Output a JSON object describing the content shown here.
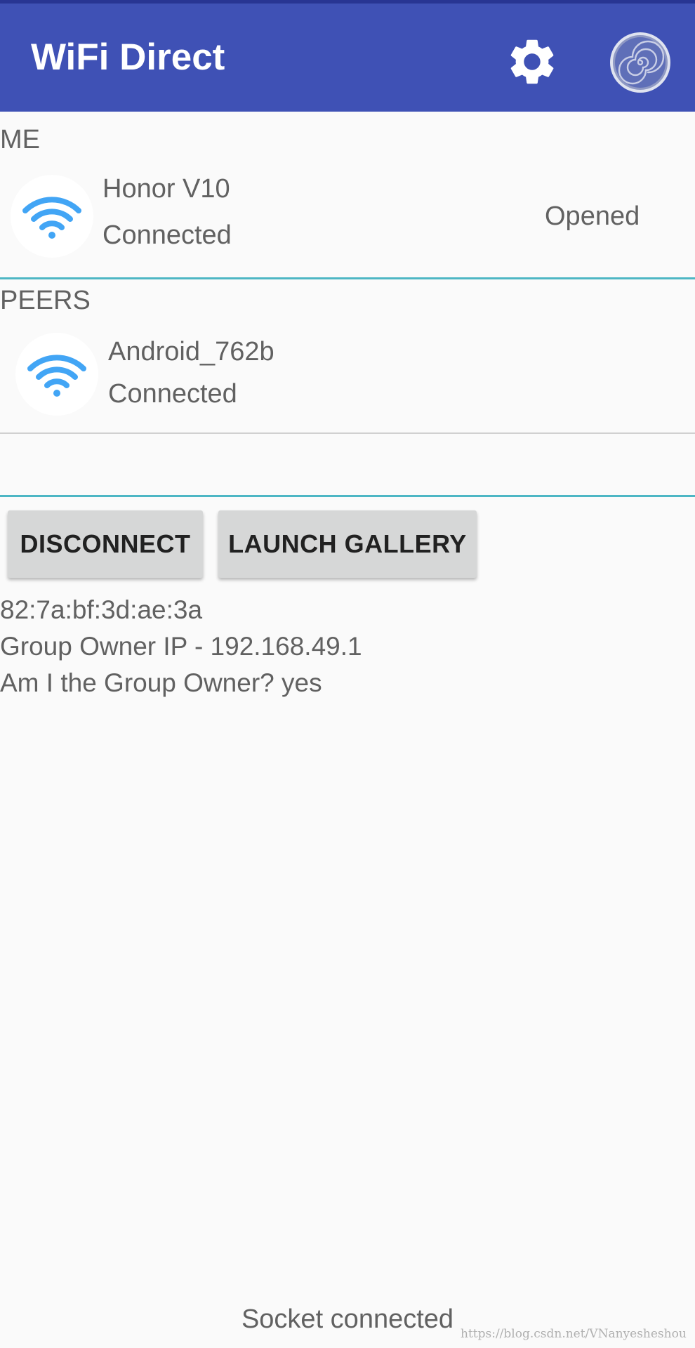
{
  "appbar": {
    "title": "WiFi Direct",
    "color": "#3f51b5",
    "actions": [
      {
        "icon": "gear-icon"
      },
      {
        "icon": "spiral-icon"
      }
    ]
  },
  "me": {
    "section_label": "ME",
    "device": {
      "name": "Honor V10",
      "status": "Connected",
      "state": "Opened",
      "icon": "wifi-icon"
    }
  },
  "peers": {
    "section_label": "PEERS",
    "items": [
      {
        "name": "Android_762b",
        "status": "Connected",
        "icon": "wifi-icon"
      }
    ]
  },
  "actions": {
    "disconnect_label": "DISCONNECT",
    "launch_gallery_label": "LAUNCH GALLERY"
  },
  "info": {
    "mac_address": "82:7a:bf:3d:ae:3a",
    "group_owner_ip": "Group Owner IP - 192.168.49.1",
    "is_group_owner": "Am I the Group Owner? yes"
  },
  "status": {
    "text": "Socket connected"
  },
  "watermark": "https://blog.csdn.net/VNanyesheshou",
  "colors": {
    "accent_divider": "#4db6c4",
    "wifi_icon": "#42a5f5"
  }
}
